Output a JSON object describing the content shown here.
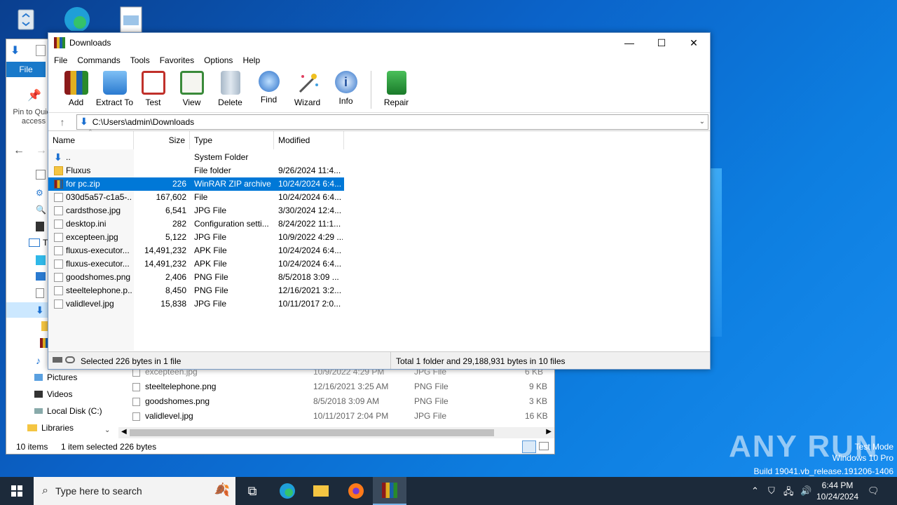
{
  "desktop": {
    "watermark_mode": "Test Mode",
    "watermark_os": "Windows 10 Pro",
    "watermark_build": "Build 19041.vb_release.191206-1406",
    "anyrun_logo": "ANY RUN"
  },
  "explorer": {
    "file_tab": "File",
    "pin_label": "Pin to Quick access",
    "tree": [
      "Th",
      "Pictures",
      "Videos",
      "Local Disk (C:)",
      "Libraries"
    ],
    "rows": [
      {
        "name": "excepteen.jpg",
        "modified": "10/9/2022 4:29 PM",
        "type": "JPG File",
        "size": "6 KB"
      },
      {
        "name": "steeltelephone.png",
        "modified": "12/16/2021 3:25 AM",
        "type": "PNG File",
        "size": "9 KB"
      },
      {
        "name": "goodshomes.png",
        "modified": "8/5/2018 3:09 AM",
        "type": "PNG File",
        "size": "3 KB"
      },
      {
        "name": "validlevel.jpg",
        "modified": "10/11/2017 2:04 PM",
        "type": "JPG File",
        "size": "16 KB"
      }
    ],
    "status_items": "10 items",
    "status_selected": "1 item selected  226 bytes"
  },
  "winrar": {
    "title": "Downloads",
    "controls": {
      "minimize": "—",
      "maximize": "☐",
      "close": "✕"
    },
    "menu": [
      "File",
      "Commands",
      "Tools",
      "Favorites",
      "Options",
      "Help"
    ],
    "toolbar": [
      {
        "label": "Add",
        "icon": "add-archive-icon",
        "color": "#b8322b"
      },
      {
        "label": "Extract To",
        "icon": "extract-folder-icon",
        "color": "#3a8fe0"
      },
      {
        "label": "Test",
        "icon": "test-clipboard-icon",
        "color": "#c0302a"
      },
      {
        "label": "View",
        "icon": "view-book-icon",
        "color": "#3a8a3a"
      },
      {
        "label": "Delete",
        "icon": "delete-trash-icon",
        "color": "#8a9aa8"
      },
      {
        "label": "Find",
        "icon": "find-magnifier-icon",
        "color": "#2a6fc8"
      },
      {
        "label": "Wizard",
        "icon": "wizard-wand-icon",
        "color": "#6a4aa0"
      },
      {
        "label": "Info",
        "icon": "info-icon",
        "color": "#2a6fc8"
      }
    ],
    "repair": {
      "label": "Repair",
      "icon": "repair-icon",
      "color": "#2a9a3a"
    },
    "path": "C:\\Users\\admin\\Downloads",
    "columns": {
      "name": "Name",
      "size": "Size",
      "type": "Type",
      "modified": "Modified"
    },
    "files": [
      {
        "name": "..",
        "size": "",
        "type": "System Folder",
        "modified": "",
        "icon": "up"
      },
      {
        "name": "Fluxus",
        "size": "",
        "type": "File folder",
        "modified": "9/26/2024 11:4...",
        "icon": "folder"
      },
      {
        "name": "for pc.zip",
        "size": "226",
        "type": "WinRAR ZIP archive",
        "modified": "10/24/2024 6:4...",
        "icon": "zip",
        "selected": true
      },
      {
        "name": "030d5a57-c1a5-...",
        "size": "167,602",
        "type": "File",
        "modified": "10/24/2024 6:4...",
        "icon": "file"
      },
      {
        "name": "cardsthose.jpg",
        "size": "6,541",
        "type": "JPG File",
        "modified": "3/30/2024 12:4...",
        "icon": "file"
      },
      {
        "name": "desktop.ini",
        "size": "282",
        "type": "Configuration setti...",
        "modified": "8/24/2022 11:1...",
        "icon": "file"
      },
      {
        "name": "excepteen.jpg",
        "size": "5,122",
        "type": "JPG File",
        "modified": "10/9/2022 4:29 ...",
        "icon": "file"
      },
      {
        "name": "fluxus-executor...",
        "size": "14,491,232",
        "type": "APK File",
        "modified": "10/24/2024 6:4...",
        "icon": "file"
      },
      {
        "name": "fluxus-executor...",
        "size": "14,491,232",
        "type": "APK File",
        "modified": "10/24/2024 6:4...",
        "icon": "file"
      },
      {
        "name": "goodshomes.png",
        "size": "2,406",
        "type": "PNG File",
        "modified": "8/5/2018 3:09 ...",
        "icon": "file"
      },
      {
        "name": "steeltelephone.p...",
        "size": "8,450",
        "type": "PNG File",
        "modified": "12/16/2021 3:2...",
        "icon": "file"
      },
      {
        "name": "validlevel.jpg",
        "size": "15,838",
        "type": "JPG File",
        "modified": "10/11/2017 2:0...",
        "icon": "file"
      }
    ],
    "status_left": "Selected 226 bytes in 1 file",
    "status_right": "Total 1 folder and 29,188,931 bytes in 10 files"
  },
  "taskbar": {
    "search_placeholder": "Type here to search",
    "time": "6:44 PM",
    "date": "10/24/2024"
  }
}
